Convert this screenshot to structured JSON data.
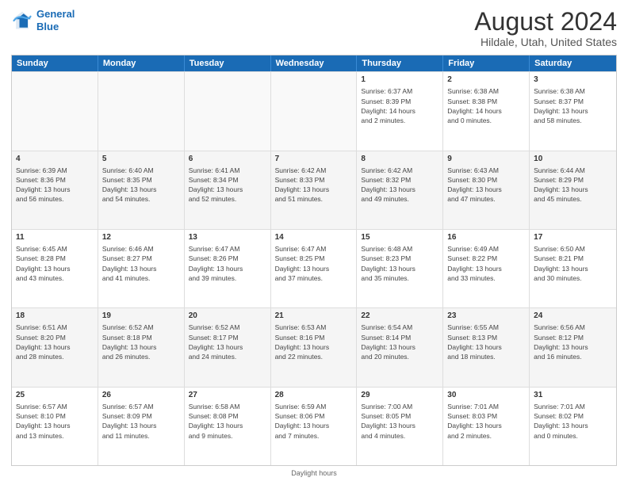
{
  "header": {
    "logo_line1": "General",
    "logo_line2": "Blue",
    "month": "August 2024",
    "location": "Hildale, Utah, United States"
  },
  "day_headers": [
    "Sunday",
    "Monday",
    "Tuesday",
    "Wednesday",
    "Thursday",
    "Friday",
    "Saturday"
  ],
  "weeks": [
    [
      {
        "num": "",
        "info": ""
      },
      {
        "num": "",
        "info": ""
      },
      {
        "num": "",
        "info": ""
      },
      {
        "num": "",
        "info": ""
      },
      {
        "num": "1",
        "info": "Sunrise: 6:37 AM\nSunset: 8:39 PM\nDaylight: 14 hours\nand 2 minutes."
      },
      {
        "num": "2",
        "info": "Sunrise: 6:38 AM\nSunset: 8:38 PM\nDaylight: 14 hours\nand 0 minutes."
      },
      {
        "num": "3",
        "info": "Sunrise: 6:38 AM\nSunset: 8:37 PM\nDaylight: 13 hours\nand 58 minutes."
      }
    ],
    [
      {
        "num": "4",
        "info": "Sunrise: 6:39 AM\nSunset: 8:36 PM\nDaylight: 13 hours\nand 56 minutes."
      },
      {
        "num": "5",
        "info": "Sunrise: 6:40 AM\nSunset: 8:35 PM\nDaylight: 13 hours\nand 54 minutes."
      },
      {
        "num": "6",
        "info": "Sunrise: 6:41 AM\nSunset: 8:34 PM\nDaylight: 13 hours\nand 52 minutes."
      },
      {
        "num": "7",
        "info": "Sunrise: 6:42 AM\nSunset: 8:33 PM\nDaylight: 13 hours\nand 51 minutes."
      },
      {
        "num": "8",
        "info": "Sunrise: 6:42 AM\nSunset: 8:32 PM\nDaylight: 13 hours\nand 49 minutes."
      },
      {
        "num": "9",
        "info": "Sunrise: 6:43 AM\nSunset: 8:30 PM\nDaylight: 13 hours\nand 47 minutes."
      },
      {
        "num": "10",
        "info": "Sunrise: 6:44 AM\nSunset: 8:29 PM\nDaylight: 13 hours\nand 45 minutes."
      }
    ],
    [
      {
        "num": "11",
        "info": "Sunrise: 6:45 AM\nSunset: 8:28 PM\nDaylight: 13 hours\nand 43 minutes."
      },
      {
        "num": "12",
        "info": "Sunrise: 6:46 AM\nSunset: 8:27 PM\nDaylight: 13 hours\nand 41 minutes."
      },
      {
        "num": "13",
        "info": "Sunrise: 6:47 AM\nSunset: 8:26 PM\nDaylight: 13 hours\nand 39 minutes."
      },
      {
        "num": "14",
        "info": "Sunrise: 6:47 AM\nSunset: 8:25 PM\nDaylight: 13 hours\nand 37 minutes."
      },
      {
        "num": "15",
        "info": "Sunrise: 6:48 AM\nSunset: 8:23 PM\nDaylight: 13 hours\nand 35 minutes."
      },
      {
        "num": "16",
        "info": "Sunrise: 6:49 AM\nSunset: 8:22 PM\nDaylight: 13 hours\nand 33 minutes."
      },
      {
        "num": "17",
        "info": "Sunrise: 6:50 AM\nSunset: 8:21 PM\nDaylight: 13 hours\nand 30 minutes."
      }
    ],
    [
      {
        "num": "18",
        "info": "Sunrise: 6:51 AM\nSunset: 8:20 PM\nDaylight: 13 hours\nand 28 minutes."
      },
      {
        "num": "19",
        "info": "Sunrise: 6:52 AM\nSunset: 8:18 PM\nDaylight: 13 hours\nand 26 minutes."
      },
      {
        "num": "20",
        "info": "Sunrise: 6:52 AM\nSunset: 8:17 PM\nDaylight: 13 hours\nand 24 minutes."
      },
      {
        "num": "21",
        "info": "Sunrise: 6:53 AM\nSunset: 8:16 PM\nDaylight: 13 hours\nand 22 minutes."
      },
      {
        "num": "22",
        "info": "Sunrise: 6:54 AM\nSunset: 8:14 PM\nDaylight: 13 hours\nand 20 minutes."
      },
      {
        "num": "23",
        "info": "Sunrise: 6:55 AM\nSunset: 8:13 PM\nDaylight: 13 hours\nand 18 minutes."
      },
      {
        "num": "24",
        "info": "Sunrise: 6:56 AM\nSunset: 8:12 PM\nDaylight: 13 hours\nand 16 minutes."
      }
    ],
    [
      {
        "num": "25",
        "info": "Sunrise: 6:57 AM\nSunset: 8:10 PM\nDaylight: 13 hours\nand 13 minutes."
      },
      {
        "num": "26",
        "info": "Sunrise: 6:57 AM\nSunset: 8:09 PM\nDaylight: 13 hours\nand 11 minutes."
      },
      {
        "num": "27",
        "info": "Sunrise: 6:58 AM\nSunset: 8:08 PM\nDaylight: 13 hours\nand 9 minutes."
      },
      {
        "num": "28",
        "info": "Sunrise: 6:59 AM\nSunset: 8:06 PM\nDaylight: 13 hours\nand 7 minutes."
      },
      {
        "num": "29",
        "info": "Sunrise: 7:00 AM\nSunset: 8:05 PM\nDaylight: 13 hours\nand 4 minutes."
      },
      {
        "num": "30",
        "info": "Sunrise: 7:01 AM\nSunset: 8:03 PM\nDaylight: 13 hours\nand 2 minutes."
      },
      {
        "num": "31",
        "info": "Sunrise: 7:01 AM\nSunset: 8:02 PM\nDaylight: 13 hours\nand 0 minutes."
      }
    ]
  ],
  "footer": "Daylight hours"
}
